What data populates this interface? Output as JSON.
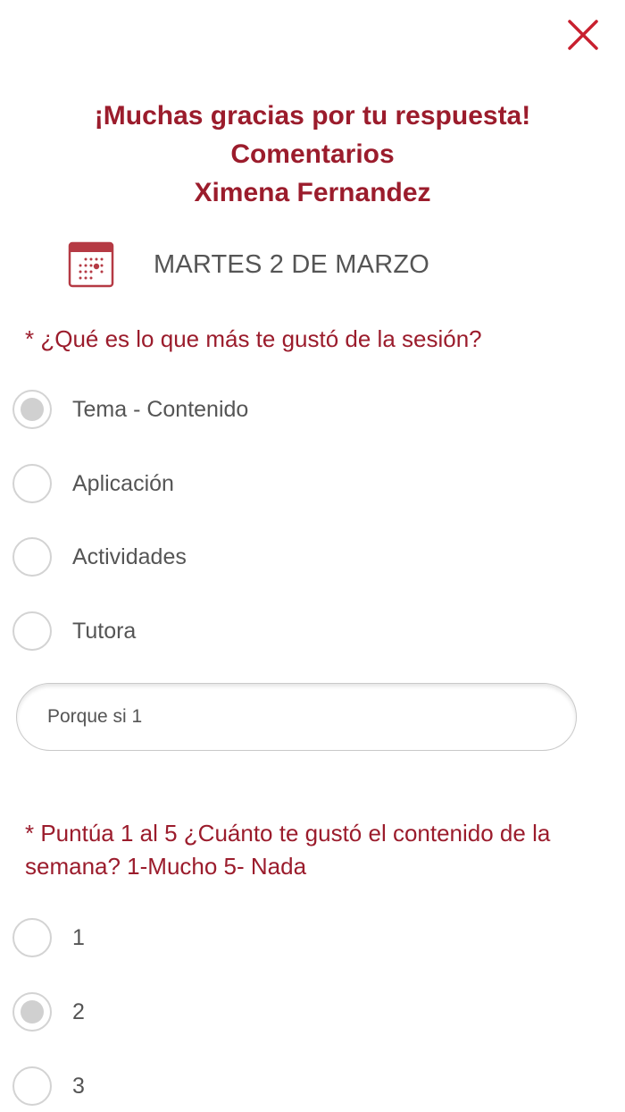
{
  "header": {
    "line1": "¡Muchas gracias por tu respuesta!",
    "line2": "Comentarios",
    "line3": "Ximena Fernandez"
  },
  "date": {
    "icon": "calendar-icon",
    "label": "MARTES 2 DE MARZO"
  },
  "question1": {
    "text": "* ¿Qué es lo que más te gustó de la sesión?",
    "options": [
      {
        "label": "Tema - Contenido",
        "selected": true
      },
      {
        "label": "Aplicación",
        "selected": false
      },
      {
        "label": "Actividades",
        "selected": false
      },
      {
        "label": "Tutora",
        "selected": false
      }
    ],
    "comment_value": "Porque si 1"
  },
  "question2": {
    "text": "* Puntúa 1 al 5 ¿Cuánto te gustó el contenido de la semana? 1-Mucho 5- Nada",
    "options": [
      {
        "label": "1",
        "selected": false
      },
      {
        "label": "2",
        "selected": true
      },
      {
        "label": "3",
        "selected": false
      }
    ]
  },
  "colors": {
    "accent": "#9b1c2c",
    "close": "#c8202f",
    "text": "#555555",
    "radio_border": "#d3d3d3",
    "radio_fill": "#d0d0d0"
  }
}
